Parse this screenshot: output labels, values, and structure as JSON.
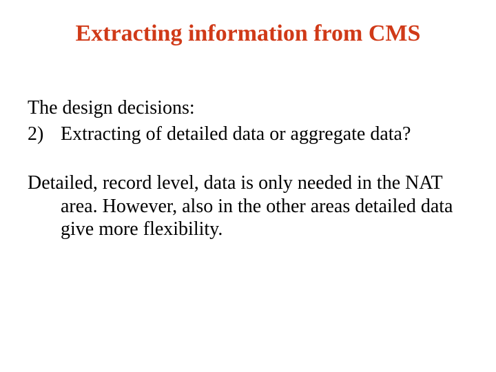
{
  "title": "Extracting information from CMS",
  "intro": "The design decisions:",
  "item_number": "2)",
  "item_text": "Extracting of detailed data or aggregate data?",
  "para2": "Detailed, record level, data is only needed in the NAT area. However, also in the other areas detailed data give more flexibility."
}
